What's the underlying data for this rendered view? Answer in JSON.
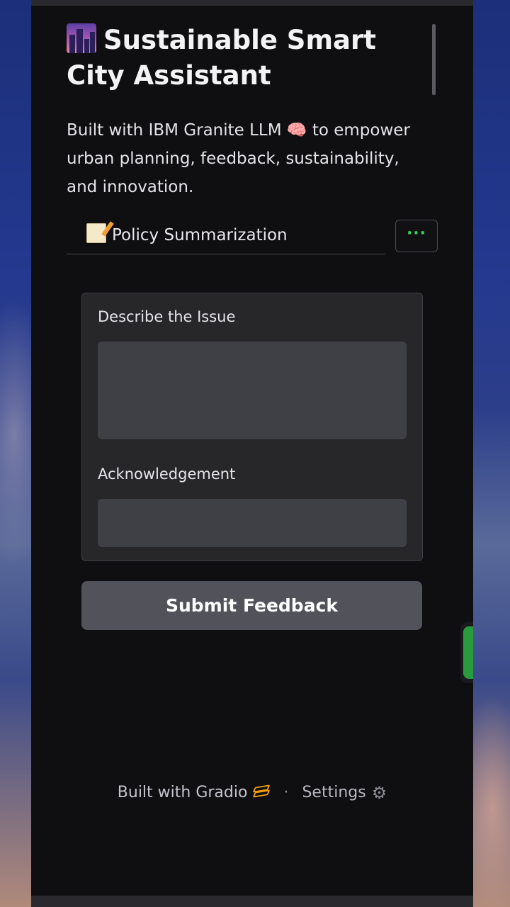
{
  "header": {
    "title": "Sustainable Smart City Assistant",
    "title_icon": "city-at-dusk-emoji",
    "description": "Built with IBM Granite LLM 🧠 to empower urban planning, feedback, sustainability, and innovation."
  },
  "tabs": {
    "active_label": "Policy Summarization",
    "active_icon": "memo-emoji",
    "more_label": "···",
    "more_color": "#2fd65a"
  },
  "form": {
    "issue_label": "Describe the Issue",
    "issue_value": "",
    "ack_label": "Acknowledgement",
    "ack_value": ""
  },
  "actions": {
    "submit_label": "Submit Feedback"
  },
  "footer": {
    "built_with": "Built with Gradio",
    "separator": "·",
    "settings": "Settings",
    "gradio_icon": "gradio-logo-icon",
    "settings_icon": "gear-icon"
  },
  "colors": {
    "background": "#0f0f11",
    "card": "#27272a",
    "input": "#3f3f46",
    "button": "#52525b",
    "accent_green": "#2fd65a",
    "gradio_orange": "#f59e0b"
  }
}
